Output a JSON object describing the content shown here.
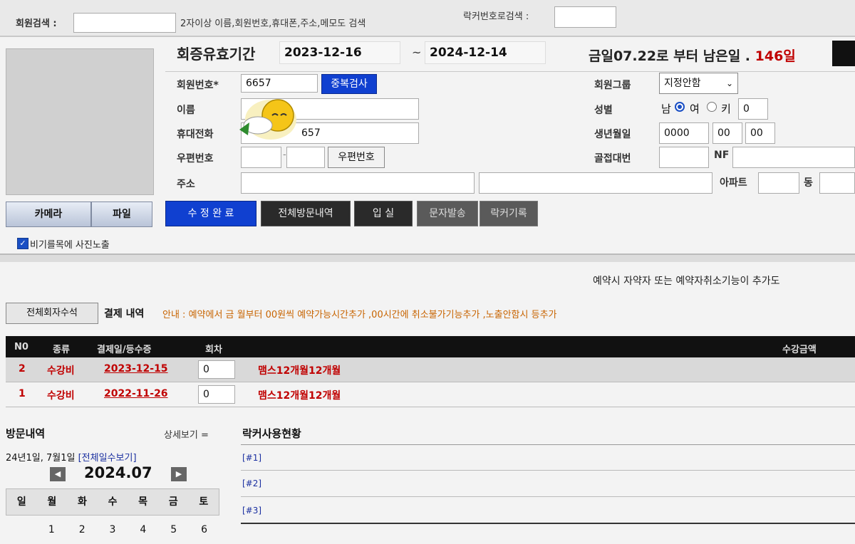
{
  "search": {
    "member_search_label": "회원검색 :",
    "member_search_hint": "2자이상 이름,회원번호,휴대폰,주소,메모도 검색",
    "locker_search_label": "락커번호로검색 :"
  },
  "profile": {
    "camera_label": "카메라",
    "file_label": "파일",
    "photo_checkbox_label": "비기를목에 사진노출"
  },
  "membership": {
    "period_label": "회증유효기간",
    "start_date": "2023-12-16",
    "end_date": "2024-12-14",
    "separator": "~",
    "remaining_prefix": "금일07.22로 부터 남은일 .",
    "remaining_days": "146일"
  },
  "form": {
    "member_no_label": "회원번호*",
    "member_no_value": "6657",
    "duplicate_check_label": "중복검사",
    "name_label": "이름",
    "phone_label": "휴대전화",
    "phone_value": "657",
    "postal_label": "우편번호",
    "postal_button_label": "우편번호",
    "address_label": "주소",
    "apt_label": "아파트",
    "dong_label": "동",
    "member_group_label": "회원그룹",
    "member_group_value": "지정안함",
    "gender_label": "성별",
    "gender_male": "남",
    "gender_female": "여",
    "key_label": "키",
    "key_value": "0",
    "birth_label": "생년월일",
    "birth_year": "0000",
    "birth_month": "00",
    "birth_day": "00",
    "locker_pw_label": "골접대번",
    "nf_label": "NF"
  },
  "actions": {
    "save_label": "수 정 완 료",
    "visit_history_label": "전체방문내역",
    "checkin_label": "입 실",
    "sms_label": "문자발송",
    "locker_label": "락커기록"
  },
  "notice": "예약시 자약자 또는 예약자취소기능이 추가도",
  "payments": {
    "full_history_button": "전체회자수석",
    "title": "결제 내역",
    "guide": "안내 : 예약에서 금 월부터 00원씩 예약가능시간추가 ,00시간에 취소불가기능추가 ,노출안함시 등추가",
    "headers": [
      "N0",
      "종류",
      "결제일/등수증",
      "회차",
      "수강금액"
    ],
    "rows": [
      {
        "no": "2",
        "type": "수강비",
        "date": "2023-12-15",
        "count": "0",
        "product": "맴스12개월12개월"
      },
      {
        "no": "1",
        "type": "수강비",
        "date": "2022-11-26",
        "count": "0",
        "product": "맴스12개월12개월"
      }
    ]
  },
  "visits": {
    "title": "방문내역",
    "detail_link": "상세보기 =",
    "summary": "24년1일, 7월1일",
    "all_days_link": "[전체일수보기]",
    "month": "2024.07",
    "weekdays": [
      "일",
      "월",
      "화",
      "수",
      "목",
      "금",
      "토"
    ],
    "first_week": [
      "",
      "1",
      "2",
      "3",
      "4",
      "5",
      "6"
    ]
  },
  "lockers": {
    "title": "락커사용현황",
    "items": [
      "[#1]",
      "[#2]",
      "[#3]"
    ]
  },
  "colors": {
    "accent_blue": "#1040d0",
    "dark_button": "#2a2a2a",
    "alert_red": "#c00000",
    "guide_orange": "#c86400"
  }
}
